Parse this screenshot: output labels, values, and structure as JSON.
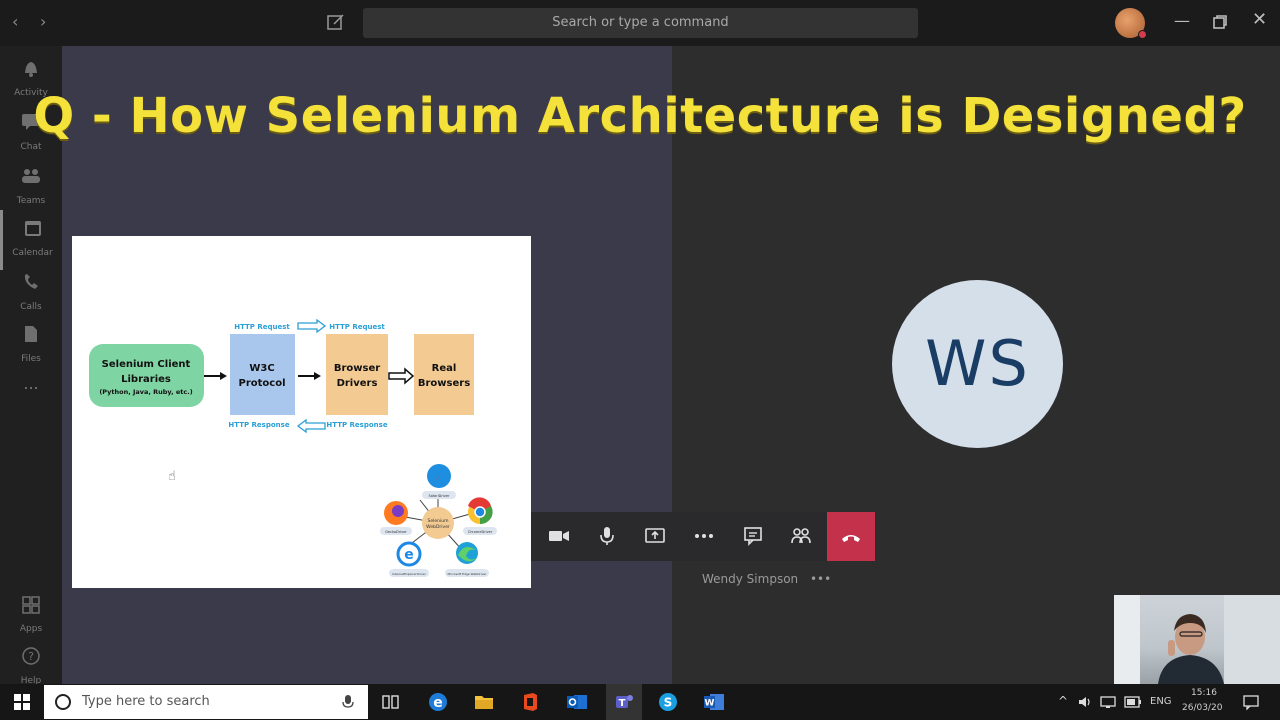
{
  "titlebar": {
    "search_placeholder": "Search or type a command"
  },
  "rail": {
    "items": [
      {
        "label": "Activity",
        "icon": "bell-icon"
      },
      {
        "label": "Chat",
        "icon": "chat-icon"
      },
      {
        "label": "Teams",
        "icon": "teams-icon"
      },
      {
        "label": "Calendar",
        "icon": "calendar-icon"
      },
      {
        "label": "Calls",
        "icon": "phone-icon"
      },
      {
        "label": "Files",
        "icon": "files-icon"
      },
      {
        "label": "...",
        "icon": "more-icon"
      },
      {
        "label": "Apps",
        "icon": "apps-icon"
      },
      {
        "label": "Help",
        "icon": "help-icon"
      }
    ]
  },
  "slide_title": "Q - How Selenium Architecture is Designed?",
  "slide": {
    "client_lib_title": "Selenium Client Libraries",
    "client_lib_line1": "Selenium Client",
    "client_lib_line2": "Libraries",
    "client_lib_sub": "(Python, Java, Ruby, etc.)",
    "w3c_line1": "W3C",
    "w3c_line2": "Protocol",
    "drivers_line1": "Browser",
    "drivers_line2": "Drivers",
    "real_line1": "Real",
    "real_line2": "Browsers",
    "http_request": "HTTP Request",
    "http_response": "HTTP Response",
    "webdriver_center_line1": "Selenium",
    "webdriver_center_line2": "WebDriver",
    "driver_labels": [
      "SafariDriver",
      "ChromeDriver",
      "GeckoDriver",
      "InternetExplorerDriver",
      "Microsoft Edge WebDriver"
    ]
  },
  "participant": {
    "initials": "WS",
    "name": "Wendy Simpson",
    "more": "•••"
  },
  "taskbar": {
    "search_placeholder": "Type here to search",
    "lang": "ENG",
    "time": "15:16",
    "date": "26/03/20"
  },
  "colors": {
    "title_yellow": "#f4e23a",
    "hangup_red": "#c4314b",
    "client_green": "#7fd4a3",
    "w3c_blue": "#a9c7ec",
    "driver_tan": "#f2ca92",
    "arrow_blue": "#2a9fd6"
  }
}
